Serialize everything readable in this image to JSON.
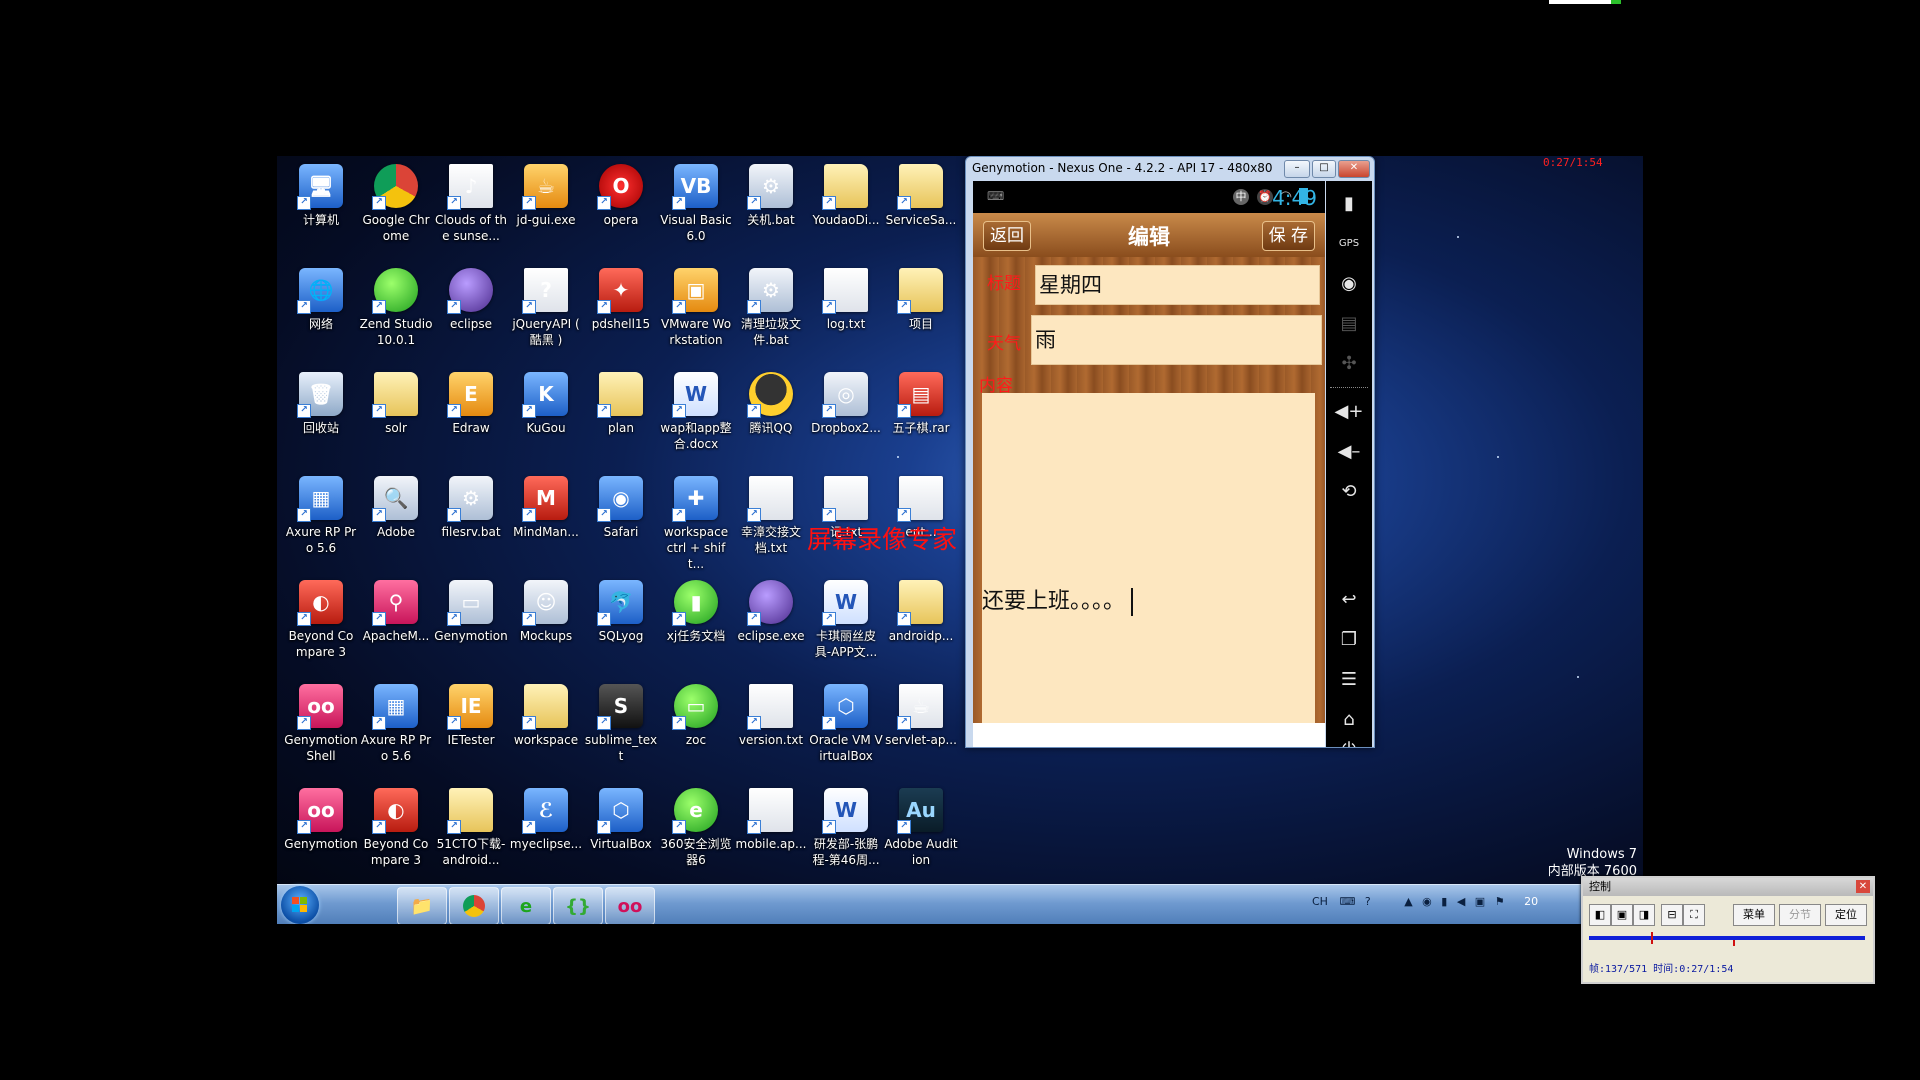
{
  "recorder": {
    "timer": "0:27/1:54"
  },
  "desktop": {
    "icons": [
      {
        "label": "计算机",
        "icon": "computer-icon",
        "color": "c-blue",
        "glyph": "🖥"
      },
      {
        "label": "Google Chrome",
        "icon": "chrome-icon",
        "color": "c-chrome",
        "glyph": ""
      },
      {
        "label": "Clouds of the sunse...",
        "icon": "mp3-file-icon",
        "color": "c-doc",
        "glyph": "♪"
      },
      {
        "label": "jd-gui.exe",
        "icon": "coffee-cup-icon",
        "color": "c-orange",
        "glyph": "☕"
      },
      {
        "label": "opera",
        "icon": "opera-icon",
        "color": "c-redbig",
        "glyph": "O"
      },
      {
        "label": "Visual Basic 6.0",
        "icon": "visual-basic-icon",
        "color": "c-blue",
        "glyph": "VB"
      },
      {
        "label": "关机.bat",
        "icon": "bat-file-icon",
        "color": "c-gear",
        "glyph": "⚙"
      },
      {
        "label": "YoudaoDi...",
        "icon": "folder-icon",
        "color": "c-folder",
        "glyph": ""
      },
      {
        "label": "ServiceSa...",
        "icon": "folder-icon",
        "color": "c-folder",
        "glyph": ""
      },
      {
        "label": "网络",
        "icon": "network-icon",
        "color": "c-blue",
        "glyph": "🌐"
      },
      {
        "label": "Zend Studio 10.0.1",
        "icon": "zend-studio-icon",
        "color": "c-green",
        "glyph": ""
      },
      {
        "label": "eclipse",
        "icon": "eclipse-icon",
        "color": "c-purple",
        "glyph": ""
      },
      {
        "label": "jQueryAPI ( 酷黑 )",
        "icon": "help-file-icon",
        "color": "c-doc",
        "glyph": "?"
      },
      {
        "label": "pdshell15",
        "icon": "pdshell-icon",
        "color": "c-red",
        "glyph": "✦"
      },
      {
        "label": "VMware Workstation",
        "icon": "vmware-icon",
        "color": "c-orange",
        "glyph": "▣"
      },
      {
        "label": "清理垃圾文件.bat",
        "icon": "bat-file-icon",
        "color": "c-gear",
        "glyph": "⚙"
      },
      {
        "label": "log.txt",
        "icon": "text-file-icon",
        "color": "c-doc",
        "glyph": ""
      },
      {
        "label": "项目",
        "icon": "folder-icon",
        "color": "c-folder",
        "glyph": ""
      },
      {
        "label": "回收站",
        "icon": "recycle-bin-icon",
        "color": "c-bin",
        "glyph": "🗑"
      },
      {
        "label": "solr",
        "icon": "folder-icon",
        "color": "c-folder",
        "glyph": ""
      },
      {
        "label": "Edraw",
        "icon": "edraw-icon",
        "color": "c-orange",
        "glyph": "E"
      },
      {
        "label": "KuGou",
        "icon": "kugou-icon",
        "color": "c-blue",
        "glyph": "K"
      },
      {
        "label": "plan",
        "icon": "folder-icon",
        "color": "c-folder",
        "glyph": ""
      },
      {
        "label": "wap和app整合.docx",
        "icon": "word-doc-icon",
        "color": "c-word",
        "glyph": "W"
      },
      {
        "label": "腾讯QQ",
        "icon": "qq-icon",
        "color": "c-qq",
        "glyph": ""
      },
      {
        "label": "Dropbox2...",
        "icon": "disc-image-icon",
        "color": "c-gear",
        "glyph": "◎"
      },
      {
        "label": "五子棋.rar",
        "icon": "rar-archive-icon",
        "color": "c-red",
        "glyph": "▤"
      },
      {
        "label": "Axure RP Pro 5.6",
        "icon": "axure-icon",
        "color": "c-blue",
        "glyph": "▦"
      },
      {
        "label": "Adobe",
        "icon": "adobe-icon",
        "color": "c-gear",
        "glyph": "🔍"
      },
      {
        "label": "filesrv.bat",
        "icon": "bat-file-icon",
        "color": "c-gear",
        "glyph": "⚙"
      },
      {
        "label": "MindMan...",
        "icon": "mindmanager-icon",
        "color": "c-red",
        "glyph": "M"
      },
      {
        "label": "Safari",
        "icon": "safari-icon",
        "color": "c-blue",
        "glyph": "◉"
      },
      {
        "label": "workspace ctrl + shift...",
        "icon": "workspace-icon",
        "color": "c-blue",
        "glyph": "✚"
      },
      {
        "label": "幸漳交接文档.txt",
        "icon": "text-file-icon",
        "color": "c-doc",
        "glyph": ""
      },
      {
        "label": "记.txt",
        "icon": "text-file-icon",
        "color": "c-doc",
        "glyph": ""
      },
      {
        "label": "ent...",
        "icon": "text-file-icon",
        "color": "c-doc",
        "glyph": ""
      },
      {
        "label": "Beyond Compare 3",
        "icon": "beyond-compare-icon",
        "color": "c-red",
        "glyph": "◐"
      },
      {
        "label": "ApacheM...",
        "icon": "apache-icon",
        "color": "c-pink",
        "glyph": "⚲"
      },
      {
        "label": "Genymotion",
        "icon": "genymotion-app-icon",
        "color": "c-gear",
        "glyph": "▭"
      },
      {
        "label": "Mockups",
        "icon": "mockups-icon",
        "color": "c-gear",
        "glyph": "☺"
      },
      {
        "label": "SQLyog",
        "icon": "sqlyog-icon",
        "color": "c-blue",
        "glyph": "🐬"
      },
      {
        "label": "xj任务文档",
        "icon": "document-icon",
        "color": "c-green",
        "glyph": "▮"
      },
      {
        "label": "eclipse.exe",
        "icon": "eclipse-icon",
        "color": "c-purple",
        "glyph": ""
      },
      {
        "label": "卡琪丽丝皮具-APP文...",
        "icon": "word-doc-icon",
        "color": "c-word",
        "glyph": "W"
      },
      {
        "label": "androidp...",
        "icon": "folder-icon",
        "color": "c-folder",
        "glyph": ""
      },
      {
        "label": "Genymotion Shell",
        "icon": "genymotion-shell-icon",
        "color": "c-pink",
        "glyph": "oo"
      },
      {
        "label": "Axure RP Pro 5.6",
        "icon": "axure-icon",
        "color": "c-blue",
        "glyph": "▦"
      },
      {
        "label": "IETester",
        "icon": "ietester-icon",
        "color": "c-orange",
        "glyph": "IE"
      },
      {
        "label": "workspace",
        "icon": "folder-icon",
        "color": "c-folder",
        "glyph": ""
      },
      {
        "label": "sublime_text",
        "icon": "sublime-icon",
        "color": "c-dark",
        "glyph": "S"
      },
      {
        "label": "zoc",
        "icon": "zoc-terminal-icon",
        "color": "c-green",
        "glyph": "▭"
      },
      {
        "label": "version.txt",
        "icon": "text-file-icon",
        "color": "c-doc",
        "glyph": ""
      },
      {
        "label": "Oracle VM VirtualBox",
        "icon": "virtualbox-icon",
        "color": "c-blue",
        "glyph": "⬡"
      },
      {
        "label": "servlet-ap...",
        "icon": "java-file-icon",
        "color": "c-doc",
        "glyph": "☕"
      },
      {
        "label": "Genymotion",
        "icon": "genymotion-icon",
        "color": "c-pink",
        "glyph": "oo"
      },
      {
        "label": "Beyond Compare 3",
        "icon": "beyond-compare-icon",
        "color": "c-red",
        "glyph": "◐"
      },
      {
        "label": "51CTO下载-android...",
        "icon": "folder-icon",
        "color": "c-folder",
        "glyph": ""
      },
      {
        "label": "myeclipse...",
        "icon": "myeclipse-icon",
        "color": "c-blue",
        "glyph": "ℰ"
      },
      {
        "label": "VirtualBox",
        "icon": "virtualbox-icon",
        "color": "c-blue",
        "glyph": "⬡"
      },
      {
        "label": "360安全浏览器6",
        "icon": "360-browser-icon",
        "color": "c-green",
        "glyph": "e"
      },
      {
        "label": "mobile.ap...",
        "icon": "text-file-icon",
        "color": "c-doc",
        "glyph": ""
      },
      {
        "label": "研发部-张鹏程-第46周...",
        "icon": "word-doc-icon",
        "color": "c-word",
        "glyph": "W"
      },
      {
        "label": "Adobe Audition",
        "icon": "adobe-audition-icon",
        "color": "c-au",
        "glyph": "Au"
      }
    ],
    "windows_label": "Windows 7",
    "windows_sublabel": "内部版本 7600"
  },
  "watermark": "屏幕录像专家  未注册",
  "genymotion": {
    "title": "Genymotion - Nexus One - 4.2.2 - API 17 - 480x800 (480x80...",
    "status_time": "4:49",
    "app": {
      "back": "返回",
      "title": "编辑",
      "save": "保 存",
      "title_label": "标题",
      "title_value": "星期四",
      "weather_label": "天气",
      "weather_value": "雨",
      "content_label": "内容",
      "content_value": "还要上班。。。。"
    },
    "sidebar": [
      "battery-icon",
      "gps-icon",
      "webcam-icon",
      "camera-icon",
      "dpad-icon",
      "volume-up-icon",
      "volume-down-icon",
      "rotate-icon",
      "back-icon",
      "recent-apps-icon",
      "menu-icon",
      "home-icon",
      "power-icon"
    ]
  },
  "taskbar": {
    "buttons": [
      "explorer-icon",
      "chrome-icon",
      "360-browser-icon",
      "brackets-icon",
      "genymotion-icon"
    ],
    "tray_text": "CH",
    "clock": "20"
  },
  "control_panel": {
    "title": "控制",
    "menu": "菜单",
    "segment": "分节",
    "locate": "定位",
    "info": "帧:137/571 时间:0:27/1:54"
  }
}
